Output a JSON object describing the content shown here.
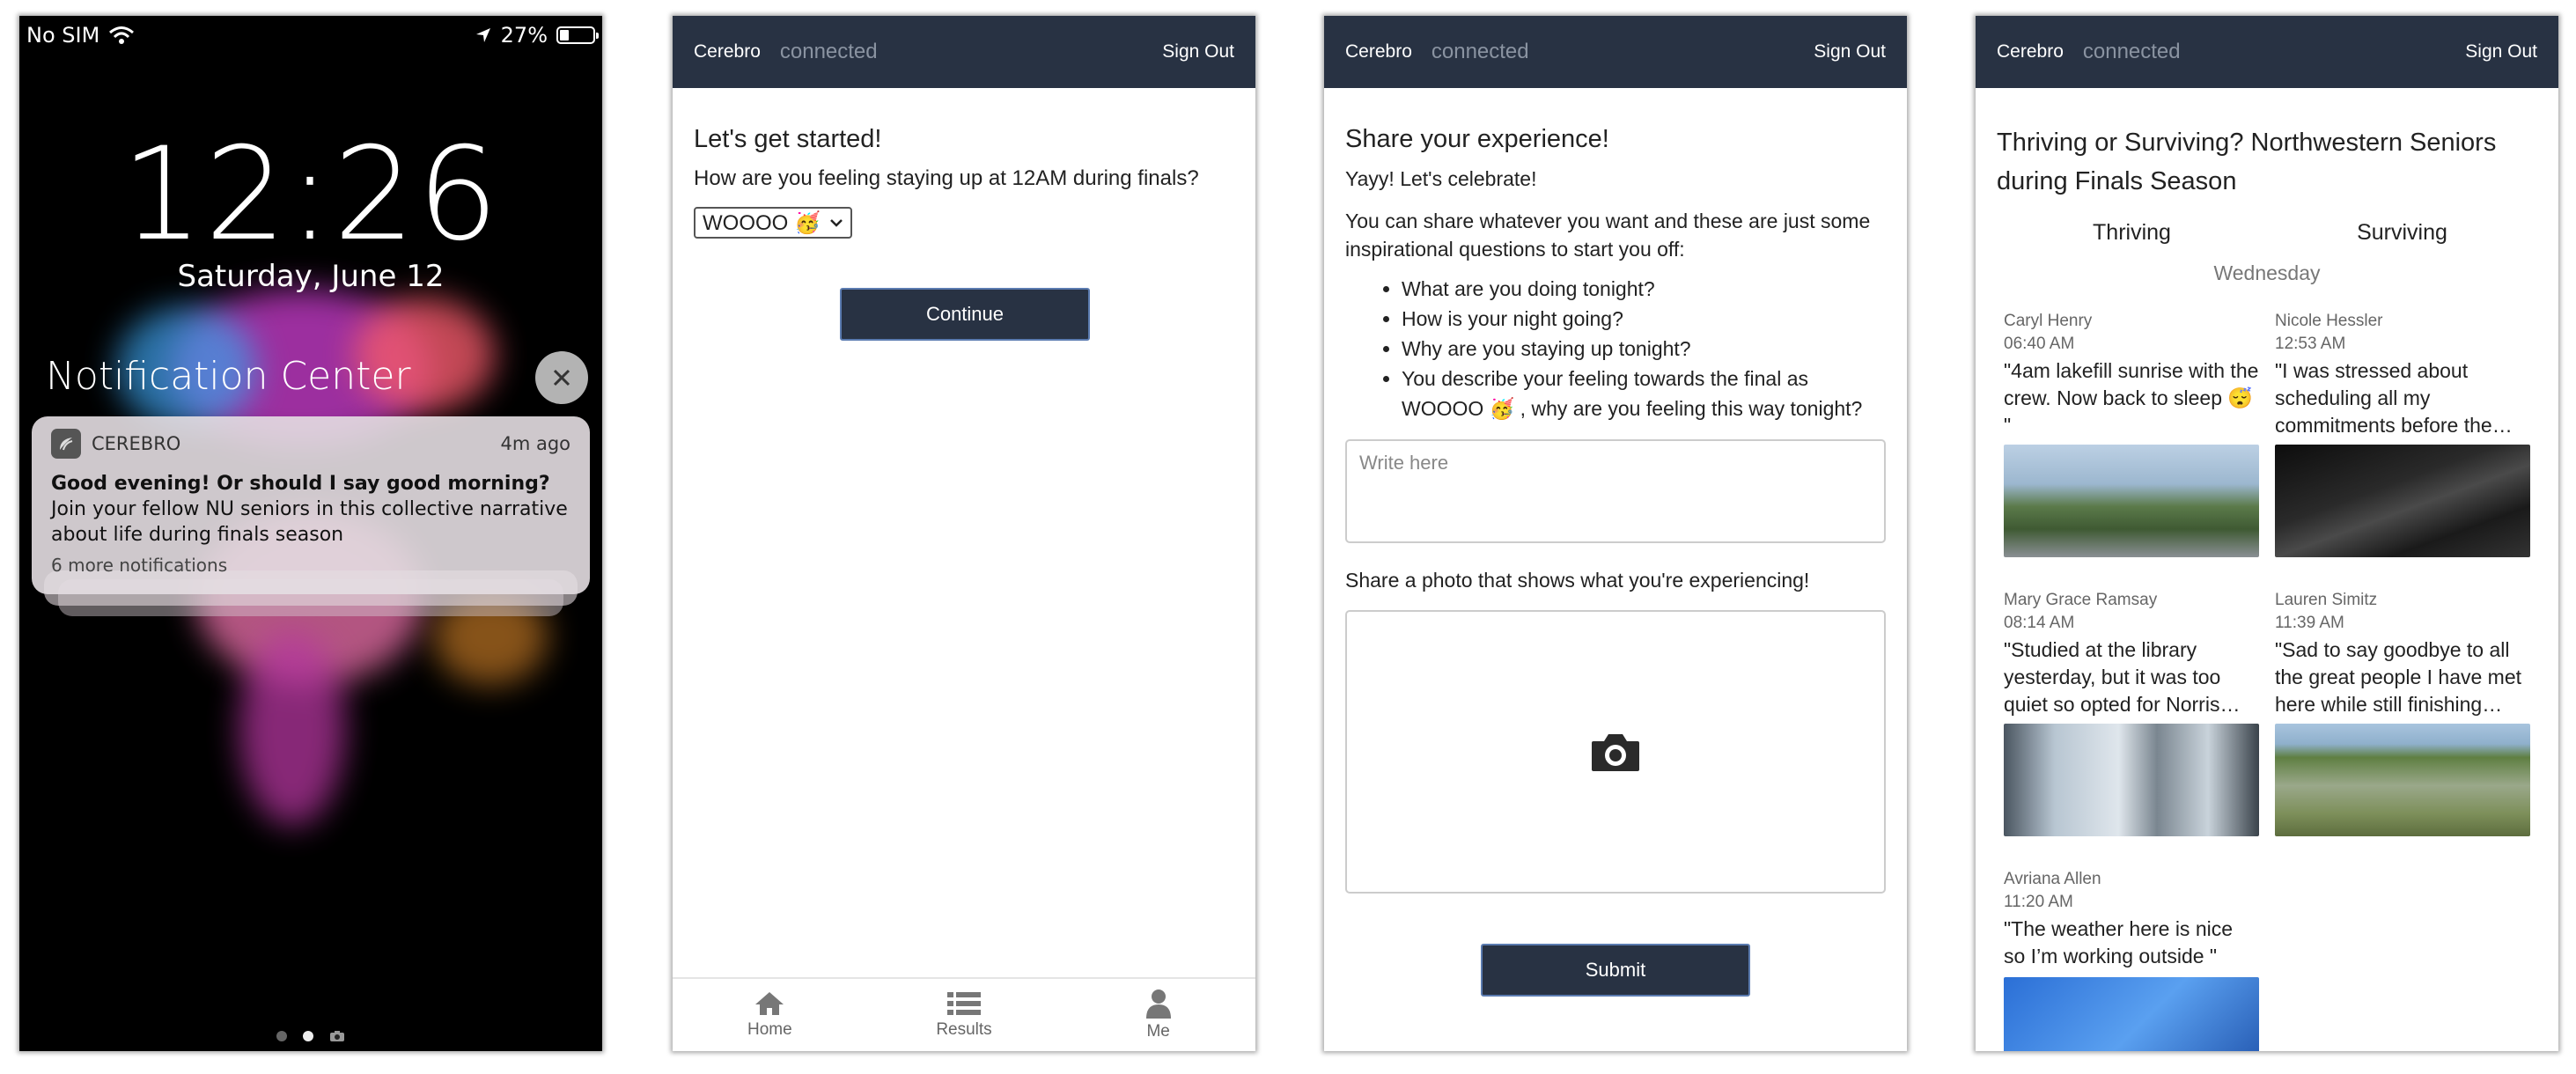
{
  "lock": {
    "carrier": "No SIM",
    "battery": "27%",
    "battery_level": 0.27,
    "time": "12:26",
    "date": "Saturday, June 12",
    "nc_title": "Notification Center",
    "notification": {
      "app": "CEREBRO",
      "age": "4m ago",
      "title": "Good evening! Or should I say good morning?",
      "body": "Join your fellow NU seniors in this collective narrative about life during finals season",
      "more": "6 more notifications"
    }
  },
  "nav": {
    "brand": "Cerebro",
    "status": "connected",
    "signout": "Sign Out"
  },
  "start": {
    "heading": "Let's get started!",
    "question": "How are you feeling staying up at 12AM during finals?",
    "select_value": "WOOOO 🥳",
    "continue": "Continue",
    "tabs": [
      "Home",
      "Results",
      "Me"
    ]
  },
  "share": {
    "heading": "Share your experience!",
    "celebrate": "Yayy! Let's celebrate!",
    "intro": "You can share whatever you want and these are just some inspirational questions to start you off:",
    "prompts": [
      "What are you doing tonight?",
      "How is your night going?",
      "Why are you staying up tonight?",
      "You describe your feeling towards the final as WOOOO 🥳 , why are you feeling this way tonight?"
    ],
    "placeholder": "Write here",
    "photo_label": "Share a photo that shows what you're experiencing!",
    "submit": "Submit"
  },
  "feed": {
    "title": "Thriving or Surviving? Northwestern Seniors during Finals Season",
    "col_left": "Thriving",
    "col_right": "Surviving",
    "day": "Wednesday",
    "posts": [
      {
        "name": "Caryl Henry",
        "time": "06:40 AM",
        "text": "\"4am lakefill sunrise with the crew. Now back to sleep 😴 \""
      },
      {
        "name": "Nicole Hessler",
        "time": "12:53 AM",
        "text": "\"I was stressed about scheduling all my commitments before the…"
      },
      {
        "name": "Mary Grace Ramsay",
        "time": "08:14 AM",
        "text": "\"Studied at the library yesterday, but it was too quiet so opted for Norris…"
      },
      {
        "name": "Lauren Simitz",
        "time": "11:39 AM",
        "text": "\"Sad to say goodbye to all the great people I have met here while still finishing…"
      },
      {
        "name": "Avriana Allen",
        "time": "11:20 AM",
        "text": "\"The weather here is nice so I’m working outside \""
      }
    ]
  }
}
